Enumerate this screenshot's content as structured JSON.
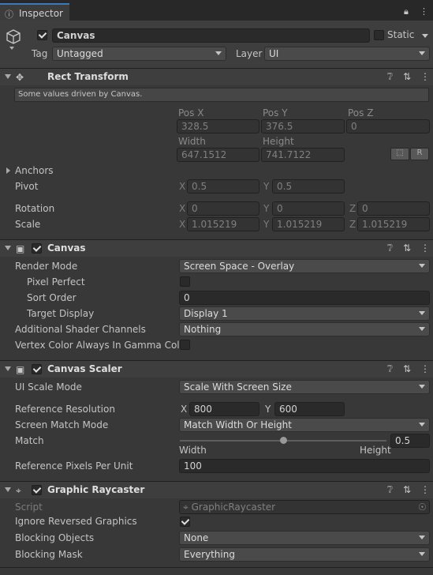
{
  "window": {
    "tab_label": "Inspector",
    "tab_icon": "info-icon"
  },
  "header": {
    "name": "Canvas",
    "active": true,
    "static_label": "Static",
    "tag_label": "Tag",
    "tag_value": "Untagged",
    "layer_label": "Layer",
    "layer_value": "UI"
  },
  "rect_transform": {
    "title": "Rect Transform",
    "help": "Some values driven by Canvas.",
    "pos_x_label": "Pos X",
    "pos_y_label": "Pos Y",
    "pos_z_label": "Pos Z",
    "pos_x": "328.5",
    "pos_y": "376.5",
    "pos_z": "0",
    "width_label": "Width",
    "height_label": "Height",
    "width": "647.1512",
    "height": "741.7122",
    "blueprint_label": "⬚",
    "raw_label": "R",
    "anchors_label": "Anchors",
    "pivot_label": "Pivot",
    "pivot_x": "0.5",
    "pivot_y": "0.5",
    "rotation_label": "Rotation",
    "rot_x": "0",
    "rot_y": "0",
    "rot_z": "0",
    "scale_label": "Scale",
    "scale_x": "1.015219",
    "scale_y": "1.015219",
    "scale_z": "1.015219",
    "x": "X",
    "y": "Y",
    "z": "Z"
  },
  "canvas": {
    "title": "Canvas",
    "enabled": true,
    "render_mode_label": "Render Mode",
    "render_mode": "Screen Space - Overlay",
    "pixel_perfect_label": "Pixel Perfect",
    "pixel_perfect": false,
    "sort_order_label": "Sort Order",
    "sort_order": "0",
    "target_display_label": "Target Display",
    "target_display": "Display 1",
    "shader_channels_label": "Additional Shader Channels",
    "shader_channels": "Nothing",
    "vertex_color_label": "Vertex Color Always In Gamma Color",
    "vertex_color": false
  },
  "canvas_scaler": {
    "title": "Canvas Scaler",
    "enabled": true,
    "ui_scale_mode_label": "UI Scale Mode",
    "ui_scale_mode": "Scale With Screen Size",
    "ref_res_label": "Reference Resolution",
    "ref_x": "800",
    "ref_y": "600",
    "match_mode_label": "Screen Match Mode",
    "match_mode": "Match Width Or Height",
    "match_label": "Match",
    "match_value": "0.5",
    "match_fraction": 0.5,
    "width_label": "Width",
    "height_label": "Height",
    "ref_ppu_label": "Reference Pixels Per Unit",
    "ref_ppu": "100"
  },
  "graphic_raycaster": {
    "title": "Graphic Raycaster",
    "enabled": true,
    "script_label": "Script",
    "script_value": "GraphicRaycaster",
    "ignore_reversed_label": "Ignore Reversed Graphics",
    "ignore_reversed": true,
    "blocking_objects_label": "Blocking Objects",
    "blocking_objects": "None",
    "blocking_mask_label": "Blocking Mask",
    "blocking_mask": "Everything"
  }
}
